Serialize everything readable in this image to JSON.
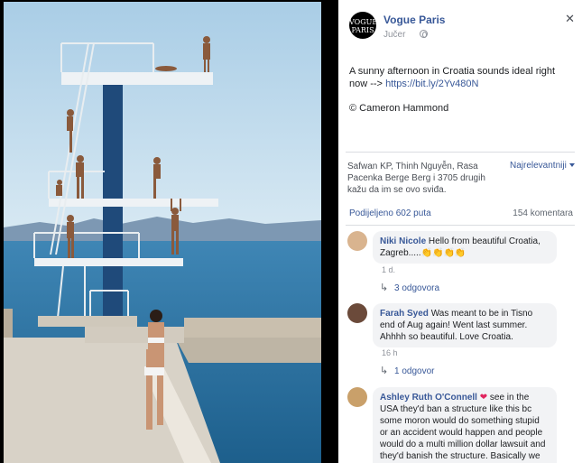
{
  "post": {
    "page_name": "Vogue Paris",
    "logo_text_line1": "VOGUE",
    "logo_text_line2": "PARIS",
    "time": "Jučer",
    "text": "A sunny afternoon in Croatia sounds ideal right now -->",
    "link": "https://bit.ly/2Yv480N",
    "credit": "© Cameron Hammond"
  },
  "reactions": {
    "likes_text": "Safwan KP, Thinh Nguyễn, Rasa Pacenka Berge Berg i 3705 drugih kažu da im se ovo sviđa.",
    "sort_label": "Najrelevantniji",
    "shares": "Podijeljeno 602 puta",
    "comment_count": "154 komentara"
  },
  "comments": [
    {
      "author": "Niki Nicole",
      "text": "Hello from beautiful Croatia, Zagreb.....👏👏👏👏",
      "time": "1 d.",
      "replies": "3 odgovora",
      "avatar_color": "#d9b48f"
    },
    {
      "author": "Farah Syed",
      "text": "Was meant to be in Tisno end of Aug again! Went last summer. Ahhhh so beautiful. Love Croatia.",
      "time": "16 h",
      "replies": "1 odgovor",
      "avatar_color": "#6b4a3a"
    },
    {
      "author": "Ashley Ruth O'Connell",
      "heart": "❤",
      "text": "see in the USA they'd ban a structure like this bc some moron would do something stupid or an accident would happen and people would do a multi million dollar lawsuit and they'd banish the structure. Basically we can't have nice fun things like other countries",
      "avatar_color": "#c9a06a"
    }
  ],
  "icons": {
    "close": "✕",
    "reply_arrow": "↳"
  }
}
